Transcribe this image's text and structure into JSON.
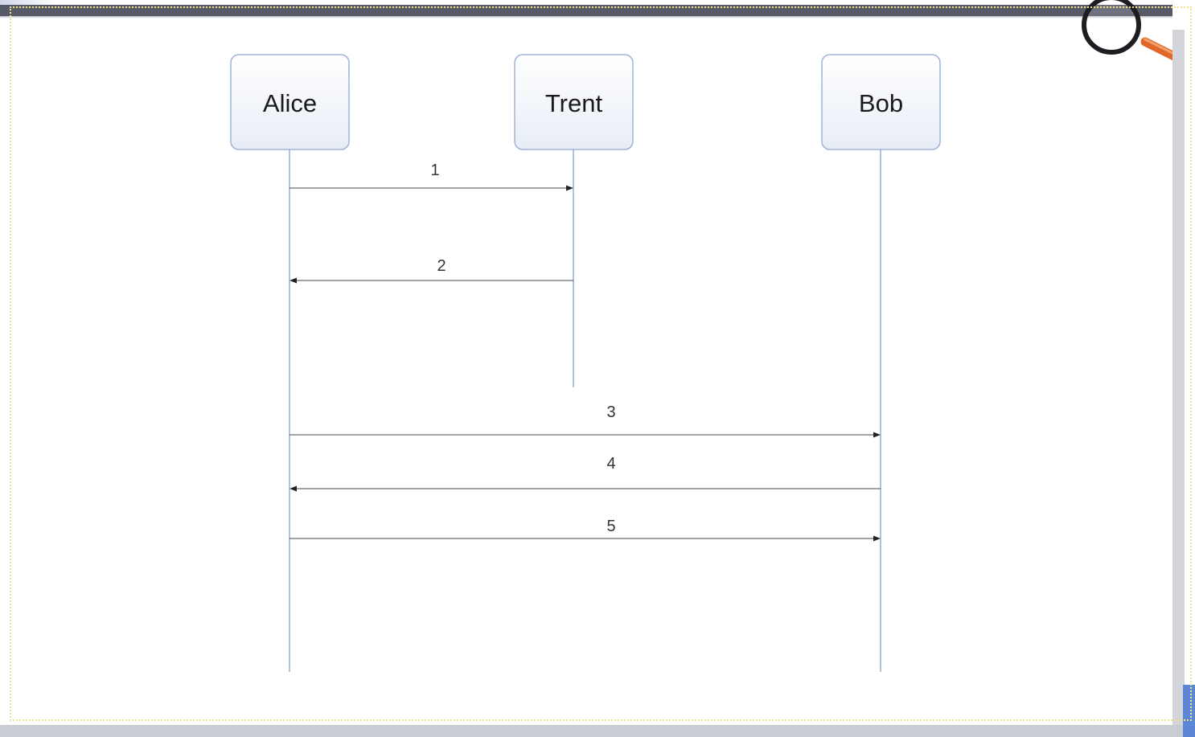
{
  "diagram": {
    "type": "sequence",
    "participants": [
      {
        "id": "alice",
        "label": "Alice"
      },
      {
        "id": "trent",
        "label": "Trent"
      },
      {
        "id": "bob",
        "label": "Bob"
      }
    ],
    "messages": [
      {
        "label": "1",
        "from": "alice",
        "to": "trent"
      },
      {
        "label": "2",
        "from": "trent",
        "to": "alice"
      },
      {
        "label": "3",
        "from": "alice",
        "to": "bob"
      },
      {
        "label": "4",
        "from": "bob",
        "to": "alice"
      },
      {
        "label": "5",
        "from": "alice",
        "to": "bob"
      }
    ]
  },
  "toolbar": {
    "zoom_icon": "magnifier-icon"
  },
  "colors": {
    "lifeline": "#9fb3d6",
    "box_border": "#9fb3d6",
    "top_bar": "#565a66",
    "magnifier_handle": "#e0672a"
  }
}
